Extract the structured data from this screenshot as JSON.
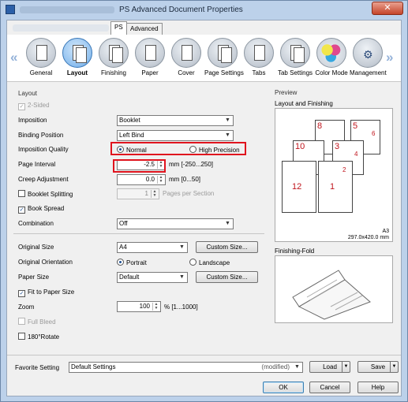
{
  "window": {
    "title": "PS Advanced Document Properties",
    "close_glyph": "✕"
  },
  "tabs": [
    {
      "label": "PS"
    },
    {
      "label": "Advanced"
    }
  ],
  "ribbon": {
    "left_arrow": "«",
    "right_arrow": "»",
    "items": [
      {
        "label": "General",
        "icon": "printer-icon"
      },
      {
        "label": "Layout",
        "icon": "layout-icon",
        "selected": true
      },
      {
        "label": "Finishing",
        "icon": "finishing-icon"
      },
      {
        "label": "Paper",
        "icon": "paper-icon"
      },
      {
        "label": "Cover",
        "icon": "cover-icon"
      },
      {
        "label": "Page Settings",
        "icon": "page-settings-icon"
      },
      {
        "label": "Tabs",
        "icon": "tabs-icon"
      },
      {
        "label": "Tab Settings",
        "icon": "tab-settings-icon"
      },
      {
        "label": "Color Mode",
        "icon": "color-mode-icon"
      },
      {
        "label": "Management",
        "icon": "gear-icon"
      }
    ]
  },
  "layout": {
    "group_label": "Layout",
    "two_sided": {
      "label": "2-Sided",
      "checked": true,
      "enabled": false
    },
    "imposition": {
      "label": "Imposition",
      "value": "Booklet"
    },
    "binding_position": {
      "label": "Binding Position",
      "value": "Left Bind"
    },
    "imposition_quality": {
      "label": "Imposition Quality",
      "options": [
        "Normal",
        "High Precision"
      ],
      "selected": "Normal"
    },
    "page_interval": {
      "label": "Page Interval",
      "value": "-2.5",
      "range": "mm [-250...250]"
    },
    "creep_adjustment": {
      "label": "Creep Adjustment",
      "value": "0.0",
      "range": "mm [0...50]"
    },
    "booklet_splitting": {
      "label": "Booklet Splitting",
      "checked": false,
      "value": "1",
      "suffix": "Pages per Section"
    },
    "book_spread": {
      "label": "Book Spread",
      "checked": true
    },
    "combination": {
      "label": "Combination",
      "value": "Off"
    },
    "original_size": {
      "label": "Original Size",
      "value": "A4",
      "button": "Custom Size..."
    },
    "original_orientation": {
      "label": "Original Orientation",
      "options": [
        "Portrait",
        "Landscape"
      ],
      "selected": "Portrait"
    },
    "paper_size": {
      "label": "Paper Size",
      "value": "Default",
      "button": "Custom Size..."
    },
    "fit_to_paper": {
      "label": "Fit to Paper Size",
      "checked": true
    },
    "zoom": {
      "label": "Zoom",
      "value": "100",
      "range": "% [1...1000]"
    },
    "full_bleed": {
      "label": "Full Bleed",
      "checked": false,
      "enabled": false
    },
    "rotate": {
      "label": "180°Rotate",
      "checked": false
    }
  },
  "preview": {
    "group_label": "Preview",
    "layout_label": "Layout and Finishing",
    "page_numbers": [
      "8",
      "5",
      "10",
      "3",
      "12",
      "1",
      "6",
      "4",
      "2"
    ],
    "paper_name": "A3",
    "paper_dims": "297.0x420.0 mm",
    "fold_label": "Finishing-Fold"
  },
  "footer": {
    "favorite_label": "Favorite Setting",
    "favorite_value": "Default Settings",
    "modified": "(modified)",
    "load": "Load",
    "save": "Save",
    "ok": "OK",
    "cancel": "Cancel",
    "help": "Help"
  }
}
